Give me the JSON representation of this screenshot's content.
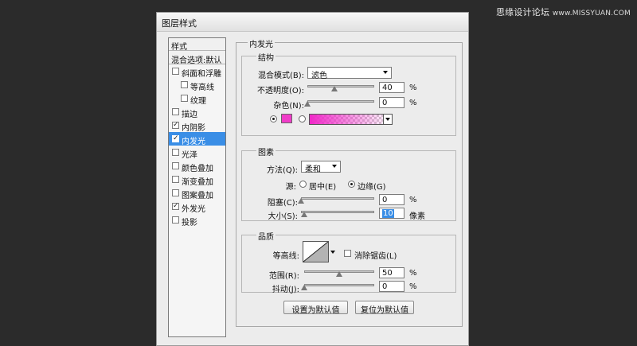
{
  "watermark": {
    "cn": "思缘设计论坛",
    "en": "www.MISSYUAN.COM"
  },
  "dialog": {
    "title": "图层样式"
  },
  "style_list": {
    "header": "样式",
    "blend_options": "混合选项:默认",
    "items": [
      {
        "label": "斜面和浮雕",
        "checked": false,
        "sub": false,
        "active": false
      },
      {
        "label": "等高线",
        "checked": false,
        "sub": true,
        "active": false
      },
      {
        "label": "纹理",
        "checked": false,
        "sub": true,
        "active": false
      },
      {
        "label": "描边",
        "checked": false,
        "sub": false,
        "active": false
      },
      {
        "label": "内阴影",
        "checked": true,
        "sub": false,
        "active": false
      },
      {
        "label": "内发光",
        "checked": true,
        "sub": false,
        "active": true
      },
      {
        "label": "光泽",
        "checked": false,
        "sub": false,
        "active": false
      },
      {
        "label": "颜色叠加",
        "checked": false,
        "sub": false,
        "active": false
      },
      {
        "label": "渐变叠加",
        "checked": false,
        "sub": false,
        "active": false
      },
      {
        "label": "图案叠加",
        "checked": false,
        "sub": false,
        "active": false
      },
      {
        "label": "外发光",
        "checked": true,
        "sub": false,
        "active": false
      },
      {
        "label": "投影",
        "checked": false,
        "sub": false,
        "active": false
      }
    ]
  },
  "panel": {
    "title": "内发光",
    "structure": {
      "title": "结构",
      "blend_mode_label": "混合模式(B):",
      "blend_mode_value": "滤色",
      "opacity_label": "不透明度(O):",
      "opacity_value": "40",
      "opacity_fraction": 0.4,
      "noise_label": "杂色(N):",
      "noise_value": "0",
      "noise_fraction": 0,
      "percent": "%",
      "color_swatch": "#f03cc8",
      "gradient_color": "#f028c8"
    },
    "elements": {
      "title": "图素",
      "technique_label": "方法(Q):",
      "technique_value": "柔和",
      "source_label": "源:",
      "center_label": "居中(E)",
      "edge_label": "边缘(G)",
      "choke_label": "阻塞(C):",
      "choke_value": "0",
      "choke_fraction": 0,
      "size_label": "大小(S):",
      "size_value": "10",
      "size_fraction": 0.04,
      "size_unit": "像素",
      "percent": "%"
    },
    "quality": {
      "title": "品质",
      "contour_label": "等高线:",
      "antialias_label": "消除锯齿(L)",
      "range_label": "范围(R):",
      "range_value": "50",
      "range_fraction": 0.5,
      "jitter_label": "抖动(J):",
      "jitter_value": "0",
      "jitter_fraction": 0,
      "percent": "%"
    },
    "buttons": {
      "make_default": "设置为默认值",
      "reset_default": "复位为默认值"
    }
  }
}
